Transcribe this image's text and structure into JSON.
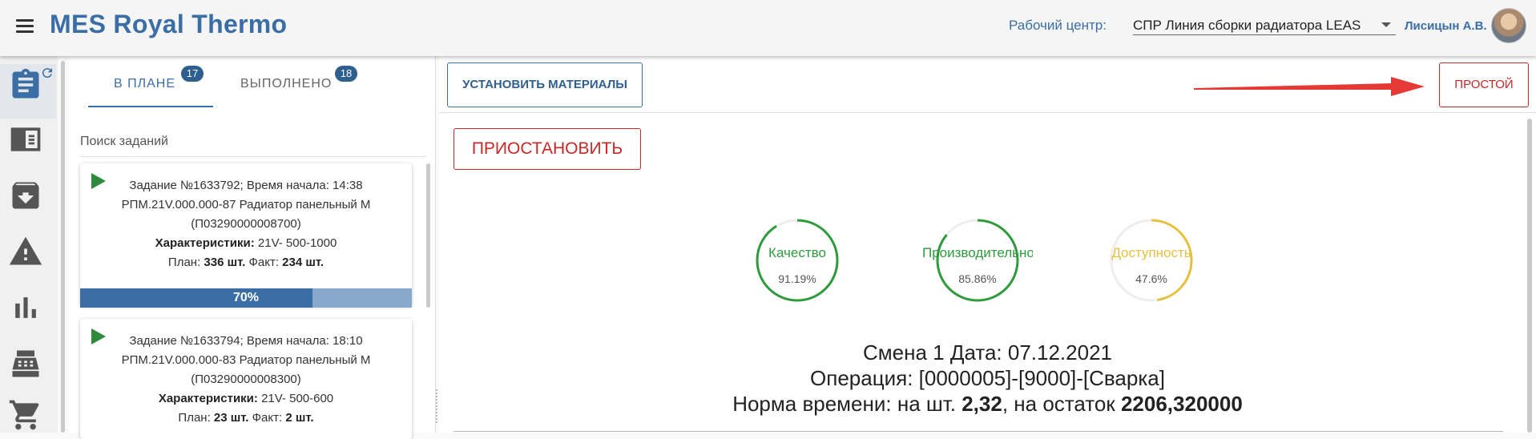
{
  "header": {
    "title": "MES Royal Thermo",
    "work_center_label": "Рабочий центр:",
    "work_center_value": "СПР Линия сборки радиатора LEAS",
    "user_name": "Лисицын А.В."
  },
  "tabs": [
    {
      "label": "В ПЛАНЕ",
      "count": "17"
    },
    {
      "label": "ВЫПОЛНЕНО",
      "count": "18"
    }
  ],
  "search": {
    "label": "Поиск заданий"
  },
  "tasks": [
    {
      "line1": "Задание №1633792; Время начала: 14:38",
      "line2": "РПМ.21V.000.000-87 Радиатор панельный М",
      "line3": "(П03290000008700)",
      "char_label": "Характеристики:",
      "char_value": " 21V- 500-1000",
      "plan_label": "План: ",
      "plan_value": "336 шт.",
      "fact_label": " Факт: ",
      "fact_value": "234 шт.",
      "progress_text": "70%",
      "progress": 0.7
    },
    {
      "line1": "Задание №1633794; Время начала: 18:10",
      "line2": "РПМ.21V.000.000-83 Радиатор панельный М",
      "line3": "(П03290000008300)",
      "char_label": "Характеристики:",
      "char_value": " 21V- 500-600",
      "plan_label": "План: ",
      "plan_value": "23 шт.",
      "fact_label": " Факт: ",
      "fact_value": "2 шт."
    }
  ],
  "main": {
    "set_materials_label": "УСТАНОВИТЬ МАТЕРИАЛЫ",
    "idle_label": "ПРОСТОЙ",
    "pause_label": "ПРИОСТАНОВИТЬ",
    "gauges": [
      {
        "title": "Качество",
        "value_text": "91.19%",
        "value": 91.19,
        "color": "#2e9b3c"
      },
      {
        "title": "Производительность",
        "value_text": "85.86%",
        "value": 85.86,
        "color": "#2e9b3c"
      },
      {
        "title": "Доступность",
        "value_text": "47.6%",
        "value": 47.6,
        "color": "#e8c040"
      }
    ],
    "shift_line": "Смена 1 Дата: 07.12.2021",
    "operation_line": "Операция: [0000005]-[9000]-[Сварка]",
    "norm_prefix": "Норма времени: на шт. ",
    "norm_piece": "2,32",
    "norm_mid": ", на остаток ",
    "norm_rest": "2206,320000"
  },
  "colors": {
    "brand": "#3b6ea5",
    "danger": "#c62828",
    "good": "#2e9b3c",
    "warn": "#e8c040"
  },
  "icons": [
    "menu-icon",
    "clipboard-icon",
    "refresh-icon",
    "sidebar-panel-icon",
    "archive-icon",
    "warning-icon",
    "bar-chart-icon",
    "cash-register-icon",
    "cart-icon",
    "play-icon",
    "avatar"
  ]
}
